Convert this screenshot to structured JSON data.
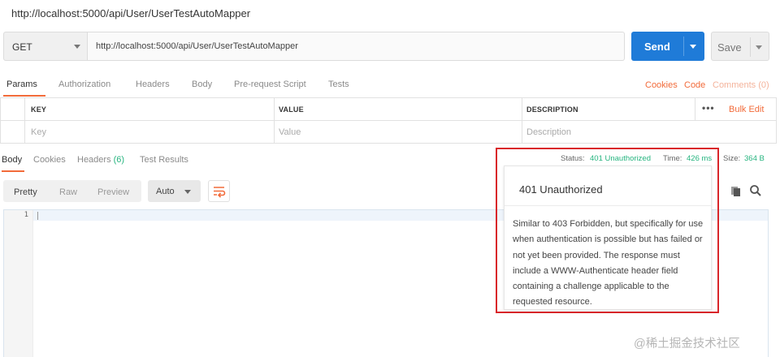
{
  "request": {
    "title": "http://localhost:5000/api/User/UserTestAutoMapper",
    "method": "GET",
    "url": "http://localhost:5000/api/User/UserTestAutoMapper",
    "send_label": "Send",
    "save_label": "Save"
  },
  "request_tabs": [
    "Params",
    "Authorization",
    "Headers",
    "Body",
    "Pre-request Script",
    "Tests"
  ],
  "request_links": {
    "cookies": "Cookies",
    "code": "Code",
    "comments": "Comments (0)"
  },
  "params_table": {
    "headers": [
      "KEY",
      "VALUE",
      "DESCRIPTION"
    ],
    "placeholders": [
      "Key",
      "Value",
      "Description"
    ],
    "more": "•••",
    "bulk_edit": "Bulk Edit"
  },
  "response_tabs": {
    "body": "Body",
    "cookies": "Cookies",
    "headers": "Headers",
    "headers_count": "(6)",
    "test_results": "Test Results"
  },
  "status": {
    "status_label": "Status:",
    "status_value": "401 Unauthorized",
    "time_label": "Time:",
    "time_value": "426 ms",
    "size_label": "Size:",
    "size_value": "364 B"
  },
  "format": {
    "pretty": "Pretty",
    "raw": "Raw",
    "preview": "Preview",
    "auto": "Auto"
  },
  "editor": {
    "line_number": "1"
  },
  "tooltip": {
    "title": "401 Unauthorized",
    "body": "Similar to 403 Forbidden, but specifically for use when authentication is possible but has failed or not yet been provided. The response must include a WWW-Authenticate header field containing a challenge applicable to the requested resource."
  },
  "watermark": "@稀土掘金技术社区",
  "colors": {
    "accent": "#f26b3a",
    "send": "#1f7bd8",
    "status_green": "#26b47f",
    "highlight_border": "#d9262a"
  }
}
